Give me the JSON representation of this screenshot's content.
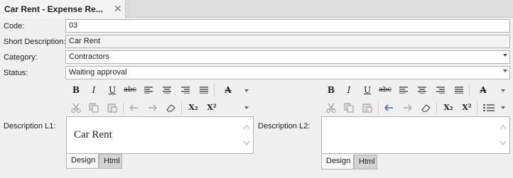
{
  "tab": {
    "title": "Car Rent - Expense Re...",
    "close_glyph": "✕"
  },
  "form": {
    "code": {
      "label": "Code:",
      "value": "03"
    },
    "short_description": {
      "label": "Short Description:",
      "value": "Car Rent"
    },
    "category": {
      "label": "Category:",
      "value": "Contractors"
    },
    "status": {
      "label": "Status:",
      "value": "Waiting approval"
    }
  },
  "toolbar_glyphs": {
    "bold": "B",
    "italic": "I",
    "underline": "U",
    "strike": "abc",
    "font_color": "A",
    "subscript": "X₂",
    "superscript": "X²"
  },
  "description_l1": {
    "label": "Description L1:",
    "content": "Car Rent",
    "tab_design": "Design",
    "tab_html": "Html"
  },
  "description_l2": {
    "label": "Description L2:",
    "content": "",
    "tab_design": "Design",
    "tab_html": "Html"
  },
  "colors": {
    "accent_blue": "#3a6fb5",
    "border": "#b4b4b4",
    "background": "#f0f0f0"
  }
}
